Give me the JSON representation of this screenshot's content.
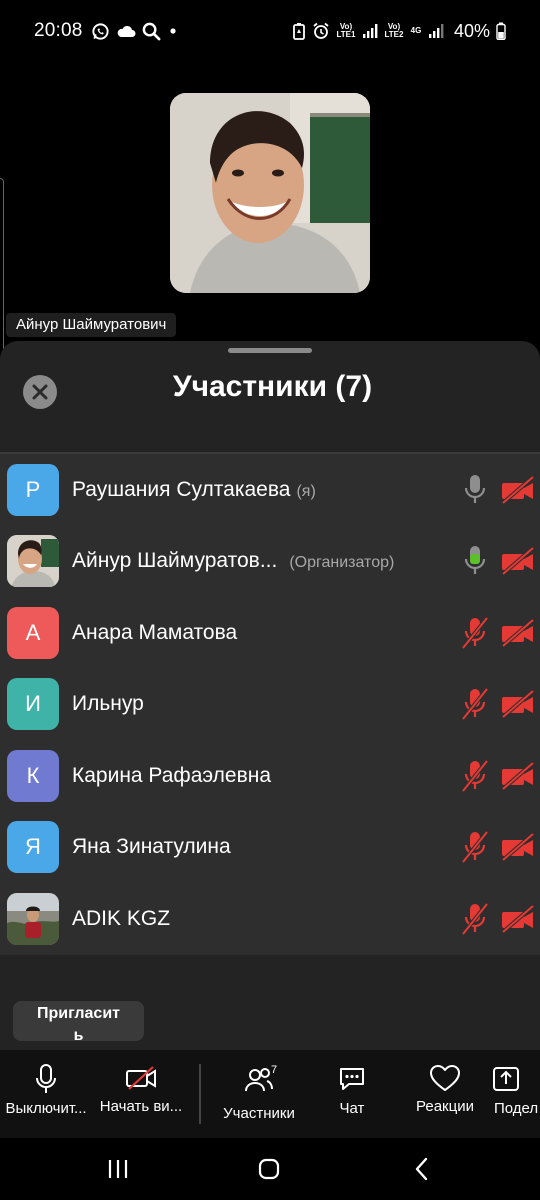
{
  "status_bar": {
    "time": "20:08",
    "battery": "40%",
    "sim1_tag": "Vo) LTE1",
    "sim2_tag": "Vo) LTE2",
    "net_tag": "4G"
  },
  "video": {
    "speaker_name": "Айнур Шаймуратович"
  },
  "sheet": {
    "title": "Участники (7)",
    "participants": [
      {
        "initial": "P",
        "name": "Раушания Султакаева",
        "note": "(я)",
        "avatar_color": "#4aa8e8",
        "mic": "off-gray",
        "video": "off"
      },
      {
        "initial": "",
        "name": "Айнур Шаймуратов...",
        "note": "(Организатор)",
        "avatar_color": "#cbbfae",
        "mic": "on-green",
        "video": "off"
      },
      {
        "initial": "А",
        "name": "Анара Маматова",
        "note": "",
        "avatar_color": "#ee5a5a",
        "mic": "muted",
        "video": "off"
      },
      {
        "initial": "И",
        "name": "Ильнур",
        "note": "",
        "avatar_color": "#3fb3a8",
        "mic": "muted",
        "video": "off"
      },
      {
        "initial": "К",
        "name": "Карина Рафаэлевна",
        "note": "",
        "avatar_color": "#6f7ad0",
        "mic": "muted",
        "video": "off"
      },
      {
        "initial": "Я",
        "name": "Яна Зинатулина",
        "note": "",
        "avatar_color": "#4aa8e8",
        "mic": "muted",
        "video": "off"
      },
      {
        "initial": "",
        "name": "ADIK KGZ",
        "note": "",
        "avatar_color": "#6d6a5e",
        "mic": "muted",
        "video": "off"
      }
    ],
    "invite_label": "Пригласит\nь"
  },
  "toolbar": {
    "mute_label": "Выключит...",
    "start_video_label": "Начать ви...",
    "participants_label": "Участники",
    "participants_count": "7",
    "chat_label": "Чат",
    "reactions_label": "Реакции",
    "share_label": "Подел"
  },
  "colors": {
    "muted_red": "#e53935",
    "mic_green": "#5cc02a",
    "sheet_bg": "#232323",
    "list_bg": "#2e2e2e"
  }
}
